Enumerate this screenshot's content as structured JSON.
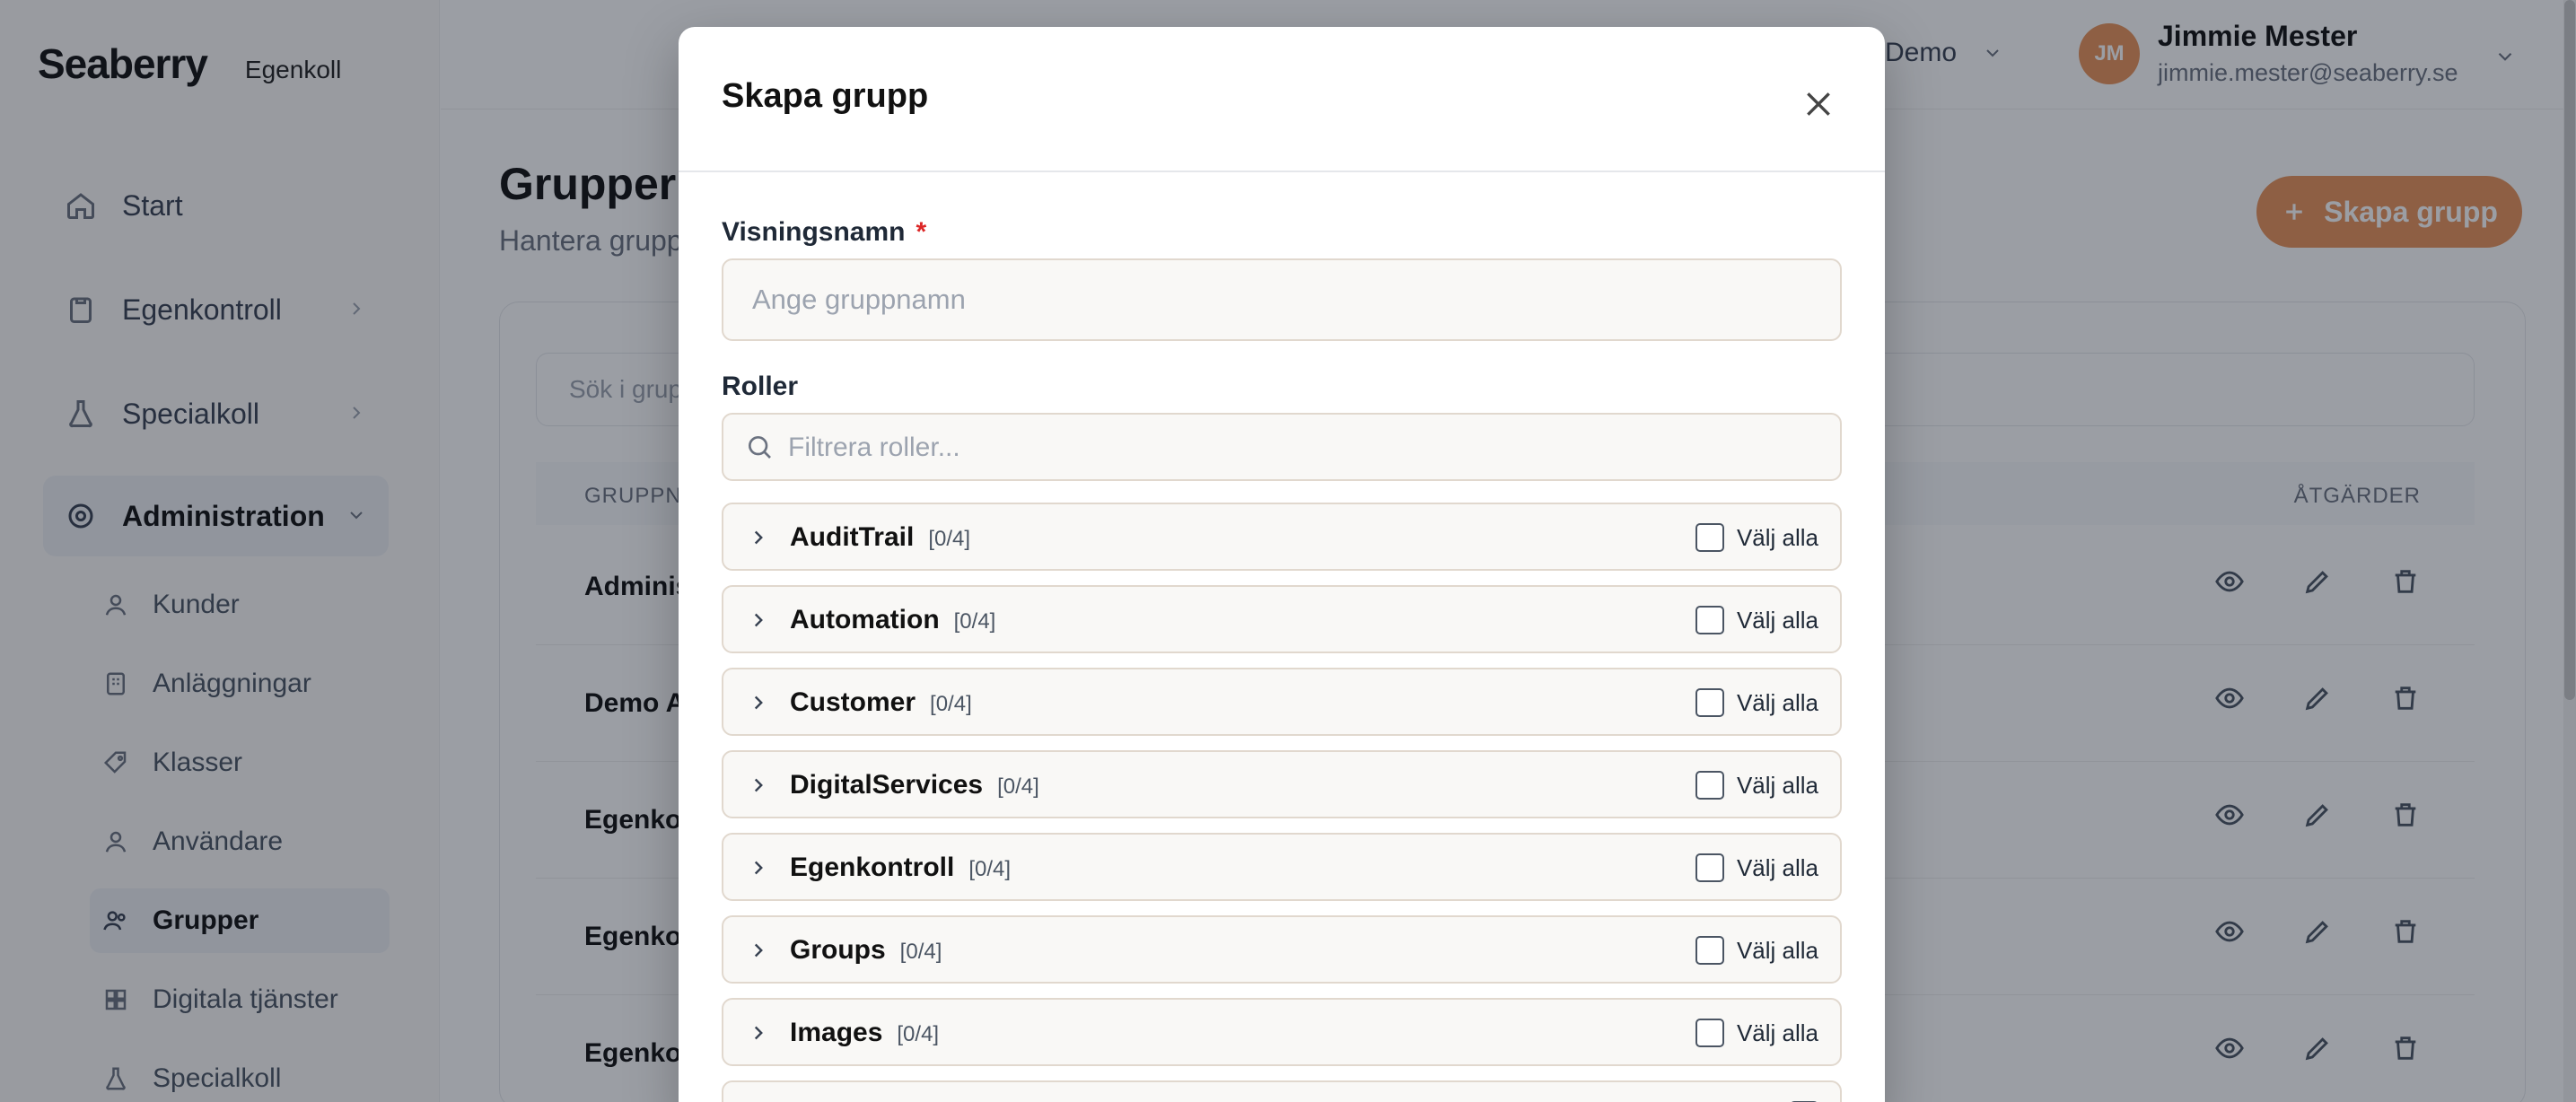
{
  "app": {
    "brand": "Seaberry",
    "brand_sub": "Egenkoll"
  },
  "sidebar": {
    "items": [
      {
        "label": "Start",
        "icon": "home-icon"
      },
      {
        "label": "Egenkontroll",
        "icon": "clipboard-icon"
      },
      {
        "label": "Specialkoll",
        "icon": "flask-icon"
      },
      {
        "label": "Administration",
        "icon": "gear-icon"
      }
    ],
    "sub_items": [
      {
        "label": "Kunder",
        "icon": "user-icon"
      },
      {
        "label": "Anläggningar",
        "icon": "building-icon"
      },
      {
        "label": "Klasser",
        "icon": "tag-icon"
      },
      {
        "label": "Användare",
        "icon": "user-icon"
      },
      {
        "label": "Grupper",
        "icon": "users-icon"
      },
      {
        "label": "Digitala tjänster",
        "icon": "grid-icon"
      },
      {
        "label": "Specialkoll",
        "icon": "flask-icon"
      }
    ]
  },
  "topbar": {
    "selector_label": "Demo",
    "avatar_initials": "JM",
    "user_name": "Jimmie Mester",
    "user_email": "jimmie.mester@seaberry.se"
  },
  "page": {
    "title": "Grupper",
    "subtitle": "Hantera grupper",
    "create_button": "Skapa grupp",
    "search_placeholder": "Sök i grupper...",
    "col_name": "GRUPPNAMN",
    "col_actions": "ÅTGÄRDER",
    "rows": [
      {
        "name": "Administratörer"
      },
      {
        "name": "Demo Admin"
      },
      {
        "name": "Egenkontroll"
      },
      {
        "name": "Egenkontroll Admin"
      },
      {
        "name": "Egenkontroll Läs"
      }
    ]
  },
  "modal": {
    "title": "Skapa grupp",
    "name_label": "Visningsnamn",
    "required_mark": "*",
    "name_placeholder": "Ange gruppnamn",
    "roles_label": "Roller",
    "roles_filter_placeholder": "Filtrera roller...",
    "select_all_label": "Välj alla",
    "roles": [
      {
        "name": "AuditTrail",
        "count": "[0/4]"
      },
      {
        "name": "Automation",
        "count": "[0/4]"
      },
      {
        "name": "Customer",
        "count": "[0/4]"
      },
      {
        "name": "DigitalServices",
        "count": "[0/4]"
      },
      {
        "name": "Egenkontroll",
        "count": "[0/4]"
      },
      {
        "name": "Groups",
        "count": "[0/4]"
      },
      {
        "name": "Images",
        "count": "[0/4]"
      },
      {
        "name": "",
        "count": ""
      }
    ]
  },
  "colors": {
    "accent": "#e8935a",
    "required": "#dc2626",
    "overlay": "rgba(17,24,39,0.42)"
  }
}
